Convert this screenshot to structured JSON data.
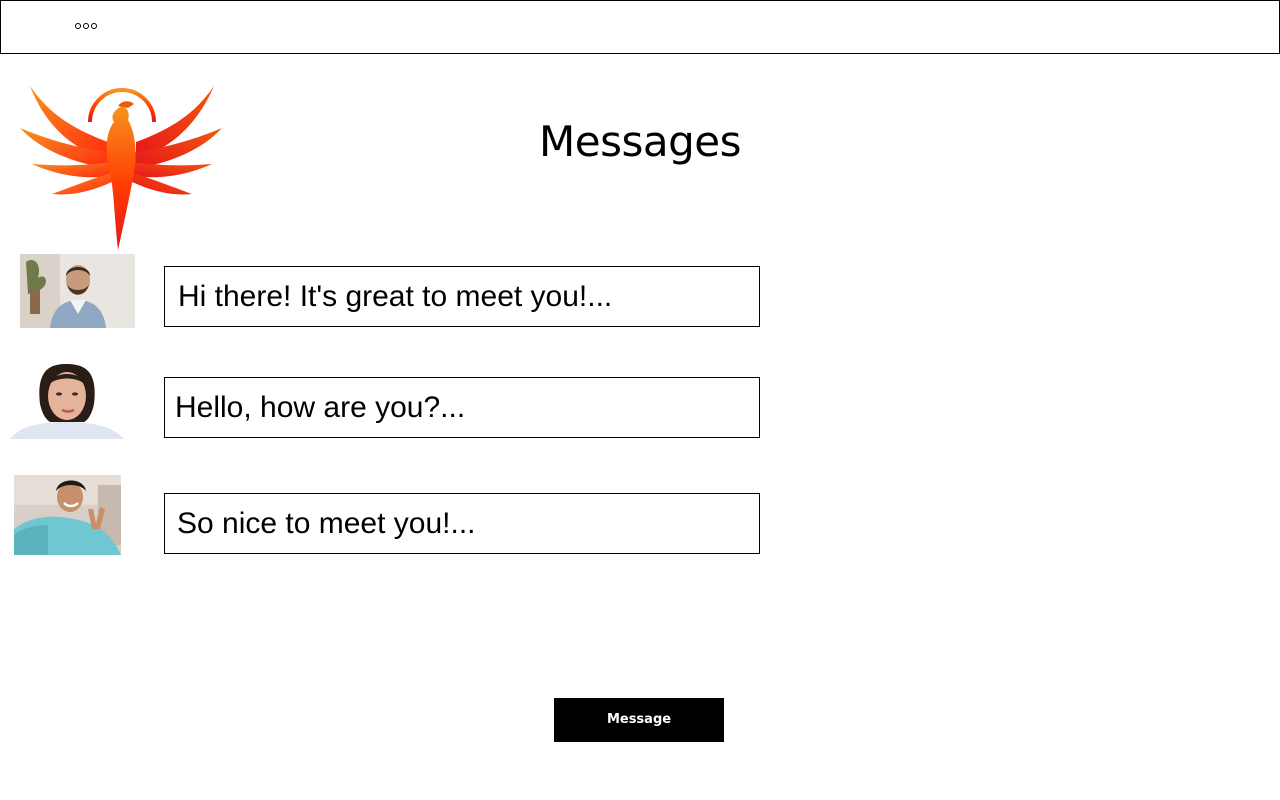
{
  "header": {
    "menu_icon": "more-dots-icon"
  },
  "logo": {
    "icon": "phoenix-logo",
    "colors": [
      "#f7931e",
      "#ff3d00",
      "#e8141b"
    ]
  },
  "page_title": "Messages",
  "conversations": [
    {
      "avatar": "man-bearded-avatar",
      "preview": "Hi there! It's great to meet you!..."
    },
    {
      "avatar": "woman-bob-hair-avatar",
      "preview": "Hello, how are you?..."
    },
    {
      "avatar": "man-peace-sign-avatar",
      "preview": "So nice to meet you!..."
    }
  ],
  "actions": {
    "message_label": "Message"
  }
}
